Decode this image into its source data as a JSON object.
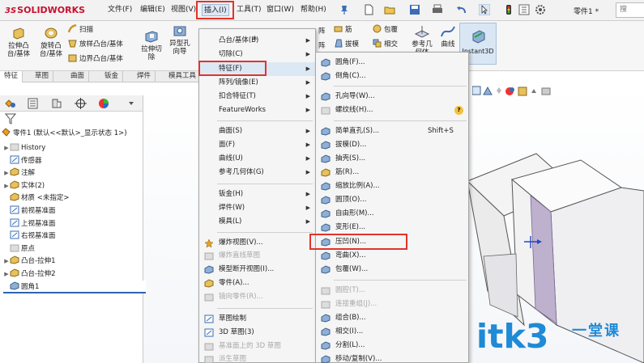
{
  "app": {
    "brand": "SOLIDWORKS",
    "brand_prefix": "3S"
  },
  "menubar": {
    "items": [
      {
        "label": "文件(F)"
      },
      {
        "label": "编辑(E)"
      },
      {
        "label": "视图(V)"
      },
      {
        "label": "插入(I)"
      },
      {
        "label": "工具(T)"
      },
      {
        "label": "窗口(W)"
      },
      {
        "label": "帮助(H)"
      }
    ],
    "part_label": "零件1 *",
    "search_placeholder": "搜"
  },
  "ribbon": {
    "buttons": [
      {
        "label": "拉伸凸\n台/基体"
      },
      {
        "label": "旋转凸\n台/基体"
      },
      {
        "label": "拉伸切\n除"
      },
      {
        "label": "异型孔\n向导"
      }
    ],
    "small_items": [
      {
        "label": "扫描"
      },
      {
        "label": "放样凸台/基体"
      },
      {
        "label": "边界凸台/基体"
      }
    ],
    "right_items": [
      {
        "label": "阵"
      },
      {
        "label": "筋"
      },
      {
        "label": "包覆"
      },
      {
        "label": "拔模"
      },
      {
        "label": "相交"
      },
      {
        "label": "参考几\n何体"
      },
      {
        "label": "曲线"
      }
    ],
    "instant3d_label": "Instant3D"
  },
  "tabs": [
    {
      "label": "特征"
    },
    {
      "label": "草图"
    },
    {
      "label": "曲面"
    },
    {
      "label": "钣金"
    },
    {
      "label": "焊件"
    },
    {
      "label": "模具工具"
    }
  ],
  "feature_tree": {
    "root": "零件1 (默认<<默认>_显示状态 1>)",
    "items": [
      {
        "label": "History",
        "expandable": true
      },
      {
        "label": "传感器",
        "expandable": false
      },
      {
        "label": "注解",
        "expandable": true
      },
      {
        "label": "实体(2)",
        "expandable": true
      },
      {
        "label": "材质 <未指定>",
        "expandable": false
      },
      {
        "label": "前视基准面",
        "expandable": false
      },
      {
        "label": "上视基准面",
        "expandable": false
      },
      {
        "label": "右视基准面",
        "expandable": false
      },
      {
        "label": "原点",
        "expandable": false
      },
      {
        "label": "凸台-拉伸1",
        "expandable": true
      },
      {
        "label": "凸台-拉伸2",
        "expandable": true
      },
      {
        "label": "圆角1",
        "expandable": false
      }
    ]
  },
  "insert_menu": {
    "items": [
      {
        "label": "凸台/基体(B)",
        "submenu": true,
        "disabled": false
      },
      {
        "label": "切除(C)",
        "submenu": true,
        "disabled": false
      },
      {
        "label": "特征(F)",
        "submenu": true,
        "disabled": false
      },
      {
        "label": "阵列/镜像(E)",
        "submenu": true,
        "disabled": false
      },
      {
        "label": "扣合特征(T)",
        "submenu": true,
        "disabled": false
      },
      {
        "label": "FeatureWorks",
        "submenu": true,
        "disabled": false
      },
      {
        "label": "曲面(S)",
        "submenu": true,
        "disabled": false
      },
      {
        "label": "面(F)",
        "submenu": true,
        "disabled": false
      },
      {
        "label": "曲线(U)",
        "submenu": true,
        "disabled": false
      },
      {
        "label": "参考几何体(G)",
        "submenu": true,
        "disabled": false
      },
      {
        "label": "钣金(H)",
        "submenu": true,
        "disabled": false
      },
      {
        "label": "焊件(W)",
        "submenu": true,
        "disabled": false
      },
      {
        "label": "模具(L)",
        "submenu": true,
        "disabled": false
      },
      {
        "label": "爆炸视图(V)...",
        "submenu": false,
        "disabled": false
      },
      {
        "label": "爆炸直线草图",
        "submenu": false,
        "disabled": true
      },
      {
        "label": "模型断开视图(I)...",
        "submenu": false,
        "disabled": false
      },
      {
        "label": "零件(A)...",
        "submenu": false,
        "disabled": false
      },
      {
        "label": "镜向零件(R)...",
        "submenu": false,
        "disabled": true
      },
      {
        "label": "草图绘制",
        "submenu": false,
        "disabled": false
      },
      {
        "label": "3D 草图(3)",
        "submenu": false,
        "disabled": false
      },
      {
        "label": "基准面上的 3D 草图",
        "submenu": false,
        "disabled": true
      },
      {
        "label": "派生草图",
        "submenu": false,
        "disabled": true
      }
    ]
  },
  "features_menu": {
    "items": [
      {
        "label": "圆角(F)...",
        "shortcut": "",
        "disabled": false
      },
      {
        "label": "倒角(C)...",
        "shortcut": "",
        "disabled": false
      },
      {
        "label": "孔向导(W)...",
        "shortcut": "",
        "disabled": false
      },
      {
        "label": "螺纹线(H)...",
        "shortcut": "",
        "disabled": false
      },
      {
        "label": "简单直孔(S)...",
        "shortcut": "Shift+S",
        "disabled": false
      },
      {
        "label": "拔模(D)...",
        "shortcut": "",
        "disabled": false
      },
      {
        "label": "抽壳(S)...",
        "shortcut": "",
        "disabled": false
      },
      {
        "label": "筋(R)...",
        "shortcut": "",
        "disabled": false
      },
      {
        "label": "缩放比例(A)...",
        "shortcut": "",
        "disabled": false
      },
      {
        "label": "圆顶(O)...",
        "shortcut": "",
        "disabled": false
      },
      {
        "label": "自由形(M)...",
        "shortcut": "",
        "disabled": false
      },
      {
        "label": "变形(E)...",
        "shortcut": "",
        "disabled": false
      },
      {
        "label": "压凹(N)...",
        "shortcut": "",
        "disabled": false
      },
      {
        "label": "弯曲(X)...",
        "shortcut": "",
        "disabled": false
      },
      {
        "label": "包覆(W)...",
        "shortcut": "",
        "disabled": false
      },
      {
        "label": "圆腔(T)...",
        "shortcut": "",
        "disabled": true
      },
      {
        "label": "连接重组(J)...",
        "shortcut": "",
        "disabled": true
      },
      {
        "label": "组合(B)...",
        "shortcut": "",
        "disabled": false
      },
      {
        "label": "相交(I)...",
        "shortcut": "",
        "disabled": false
      },
      {
        "label": "分割(L)...",
        "shortcut": "",
        "disabled": false
      },
      {
        "label": "移动/复制(V)...",
        "shortcut": "",
        "disabled": false
      }
    ]
  },
  "watermark": {
    "text": "itk3",
    "sub": "一堂课"
  },
  "colors": {
    "brand_red": "#c8102e",
    "highlight_box": "#e2332b",
    "watermark_blue": "#1f8ad6"
  }
}
